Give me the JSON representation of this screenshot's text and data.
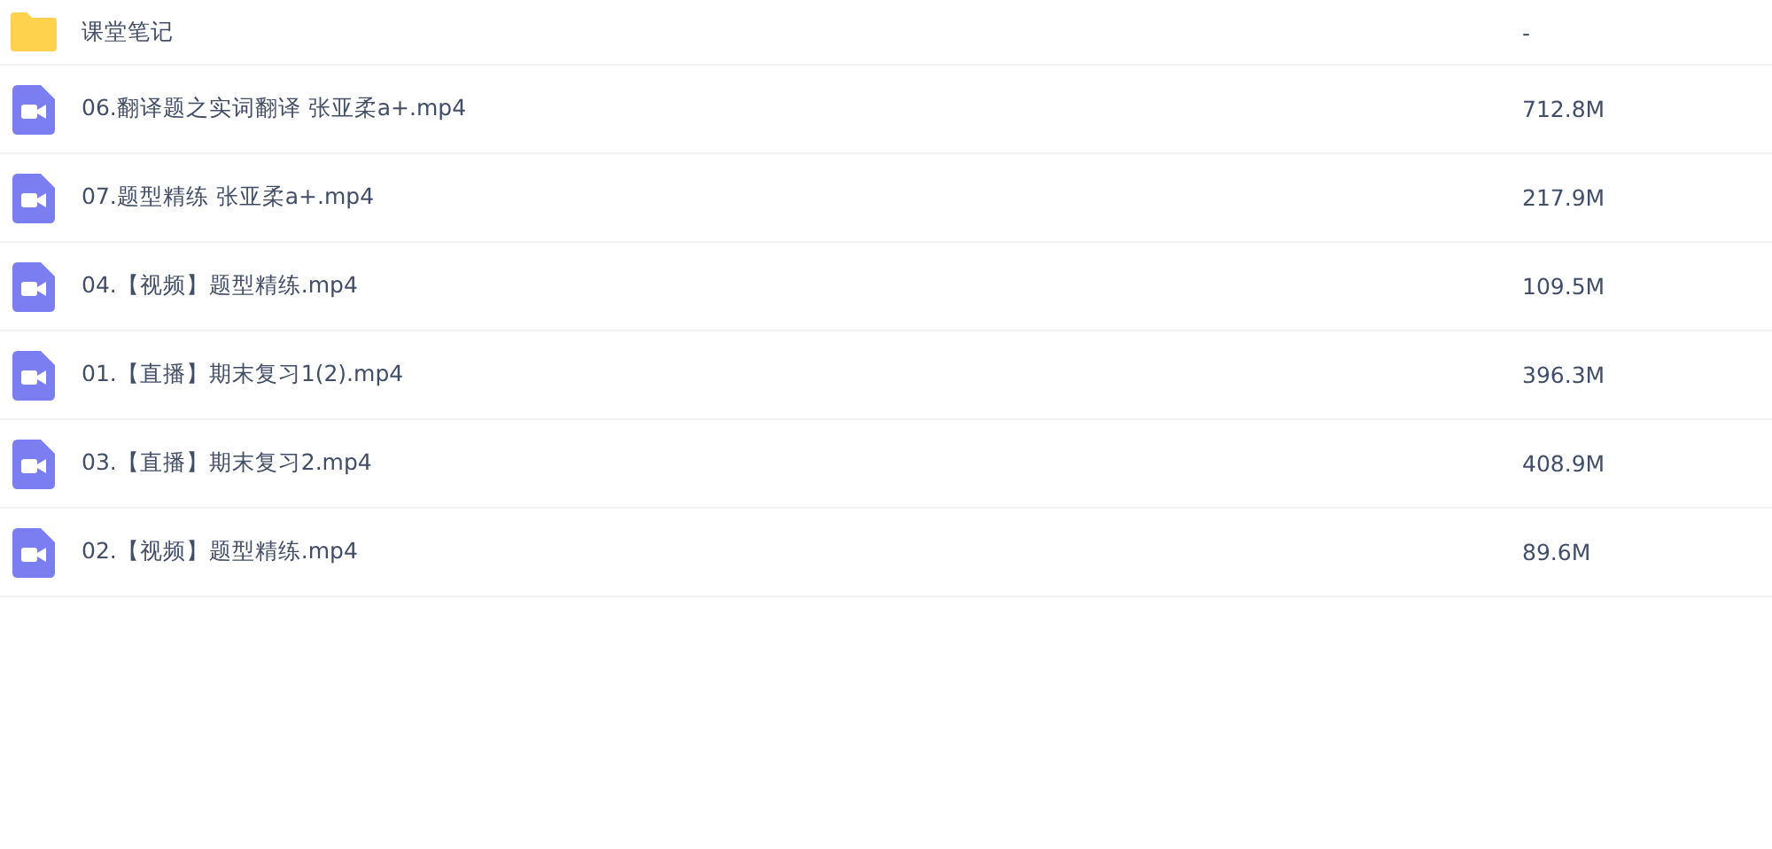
{
  "files": [
    {
      "kind": "folder",
      "name": "课堂笔记",
      "size": "-"
    },
    {
      "kind": "video",
      "name": "06.翻译题之实词翻译 张亚柔a+.mp4",
      "size": "712.8M"
    },
    {
      "kind": "video",
      "name": "07.题型精练 张亚柔a+.mp4",
      "size": "217.9M"
    },
    {
      "kind": "video",
      "name": "04.【视频】题型精练.mp4",
      "size": "109.5M"
    },
    {
      "kind": "video",
      "name": "01.【直播】期末复习1(2).mp4",
      "size": "396.3M"
    },
    {
      "kind": "video",
      "name": "03.【直播】期末复习2.mp4",
      "size": "408.9M"
    },
    {
      "kind": "video",
      "name": "02.【视频】题型精练.mp4",
      "size": "89.6M"
    }
  ]
}
